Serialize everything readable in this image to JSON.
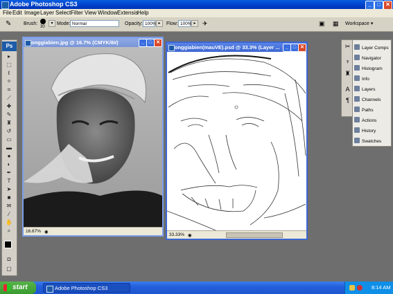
{
  "app": {
    "title": "Adobe Photoshop CS3",
    "icon": "photoshop-icon"
  },
  "window_controls": {
    "minimize": "_",
    "maximize": "□",
    "close": "✕"
  },
  "menu": [
    "File",
    "Edit",
    "Image",
    "Layer",
    "Select",
    "Filter",
    "View",
    "Window",
    "Extensis",
    "Help"
  ],
  "options": {
    "brush_label": "Brush:",
    "brush_size": "30",
    "mode_label": "Mode:",
    "mode_value": "Normal",
    "opacity_label": "Opacity:",
    "opacity_value": "100%",
    "flow_label": "Flow:",
    "flow_value": "100%",
    "workspace_label": "Workspace ▾"
  },
  "toolbox": {
    "logo": "Ps",
    "tools": [
      "move-tool",
      "marquee-tool",
      "lasso-tool",
      "magic-wand-tool",
      "crop-tool",
      "slice-tool",
      "healing-brush-tool",
      "brush-tool",
      "clone-stamp-tool",
      "history-brush-tool",
      "eraser-tool",
      "gradient-tool",
      "blur-tool",
      "dodge-tool",
      "pen-tool",
      "type-tool",
      "path-selection-tool",
      "shape-tool",
      "notes-tool",
      "eyedropper-tool",
      "hand-tool",
      "zoom-tool"
    ]
  },
  "documents": [
    {
      "title": "onggiabien.jpg @ 16.7% (CMYK/8#)",
      "zoom": "16.67%",
      "active": false
    },
    {
      "title": "onggiabien(mauVE).psd @ 33.3% (Layer ...",
      "zoom": "33.33%",
      "active": true
    }
  ],
  "panels": [
    {
      "label": "Layer Comps",
      "icon": "layer-comps-icon"
    },
    {
      "label": "Navigator",
      "icon": "navigator-icon"
    },
    {
      "label": "Histogram",
      "icon": "histogram-icon"
    },
    {
      "label": "Info",
      "icon": "info-icon"
    },
    {
      "label": "Layers",
      "icon": "layers-icon"
    },
    {
      "label": "Channels",
      "icon": "channels-icon"
    },
    {
      "label": "Paths",
      "icon": "paths-icon"
    },
    {
      "label": "Actions",
      "icon": "actions-icon"
    },
    {
      "label": "History",
      "icon": "history-icon"
    },
    {
      "label": "Swatches",
      "icon": "swatches-icon"
    }
  ],
  "taskbar": {
    "start_label": "start",
    "task_item": "Adobe Photoshop CS3",
    "clock": "8:14 AM"
  },
  "colors": {
    "xp_blue": "#245edb",
    "start_green": "#3a9a2f",
    "ps_blue": "#1e5ba8",
    "workspace_gray": "#6e6e6e"
  }
}
